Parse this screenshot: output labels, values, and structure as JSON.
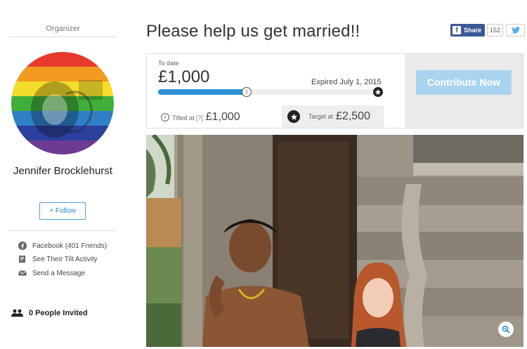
{
  "sidebar": {
    "organizer_label": "Organizer",
    "name": "Jennifer Brocklehurst",
    "follow_label": "+ Follow",
    "links": [
      {
        "icon": "facebook-icon",
        "label": "Facebook (401 Friends)"
      },
      {
        "icon": "activity-icon",
        "label": "See Their Tilt Activity"
      },
      {
        "icon": "envelope-icon",
        "label": "Send a Message"
      }
    ],
    "invited_label": "0 People Invited"
  },
  "header": {
    "title": "Please help us get married!!",
    "share_label": "Share",
    "share_count": "152"
  },
  "funding": {
    "to_date_label": "To date",
    "raised": "£1,000",
    "expired": "Expired July 1, 2015",
    "progress_fraction": 0.4,
    "tilted_label": "Tilted at",
    "tilted_help": "[?]",
    "tilted_amount": "£1,000",
    "target_label": "Target at",
    "target_amount": "£2,500",
    "cta_label": "Contribute Now"
  },
  "colors": {
    "accent": "#2f8fd5",
    "cta": "#a9d3ef",
    "facebook": "#3b5998",
    "twitter": "#55acee"
  }
}
